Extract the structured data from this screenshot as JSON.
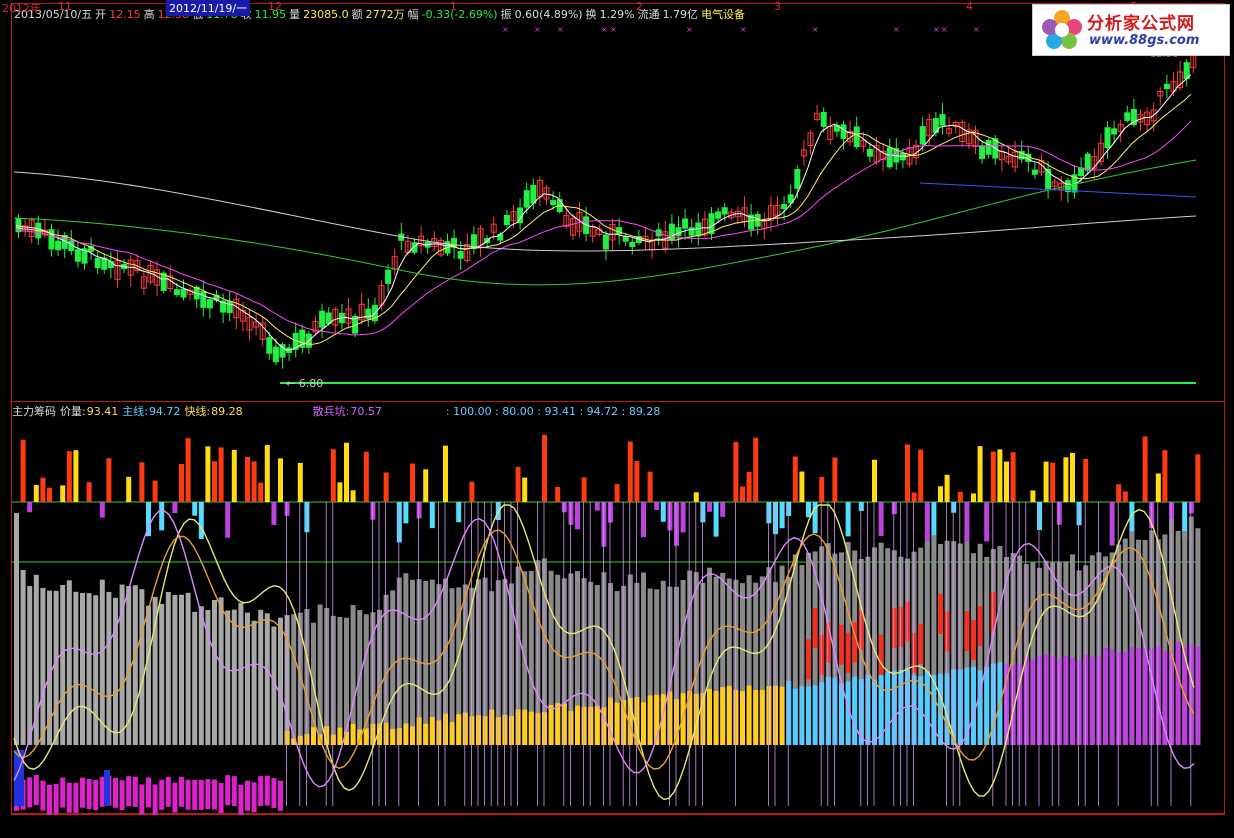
{
  "header": {
    "date": "2013/05/10/五",
    "open_label": "开",
    "open": "12.15",
    "high_label": "高",
    "high": "12.38",
    "low_label": "低",
    "low": "11.78",
    "close_label": "收",
    "close": "11.95",
    "volume_label": "量",
    "volume": "23085.0",
    "amount_label": "额",
    "amount": "2772万",
    "change_label": "幅",
    "change": "-0.33(-2.69%)",
    "amplitude_label": "振",
    "amplitude": "0.60(4.89%)",
    "turnover_label": "换",
    "turnover": "1.29%",
    "float_label": "流通",
    "float": "1.79亿",
    "sector": "电气设备"
  },
  "price_panel": {
    "low_marker": "6.80",
    "top_right_value": "12.38"
  },
  "indicator": {
    "name": "主力筹码",
    "price_vol_label": "价量:",
    "price_vol": "93.41",
    "main_label": "主线:",
    "main": "94.72",
    "fast_label": "快线:",
    "fast": "89.28",
    "scatter_label": "散兵坑:",
    "scatter": "70.57",
    "levels": ": 100.00 : 80.00 : 93.41 : 94.72 : 89.28"
  },
  "date_axis": {
    "labels": [
      "2012年",
      "11",
      "12",
      "1",
      "2",
      "3",
      "4",
      "5"
    ],
    "cursor_date": "2012/11/19/一"
  },
  "logo": {
    "title": "分析家公式网",
    "url": "www.88gs.com"
  },
  "colors": {
    "up": "#ff3b3b",
    "down": "#22ee44",
    "ma5": "#ffffff",
    "ma10": "#ffee66",
    "ma20": "#ff44ff",
    "ma60": "#33cc33",
    "ma120": "#cfcfcf",
    "panel_border": "#c01818",
    "main_line": "#e8e870",
    "fast_line": "#e8a030",
    "scatter_line": "#dd88ff"
  }
}
